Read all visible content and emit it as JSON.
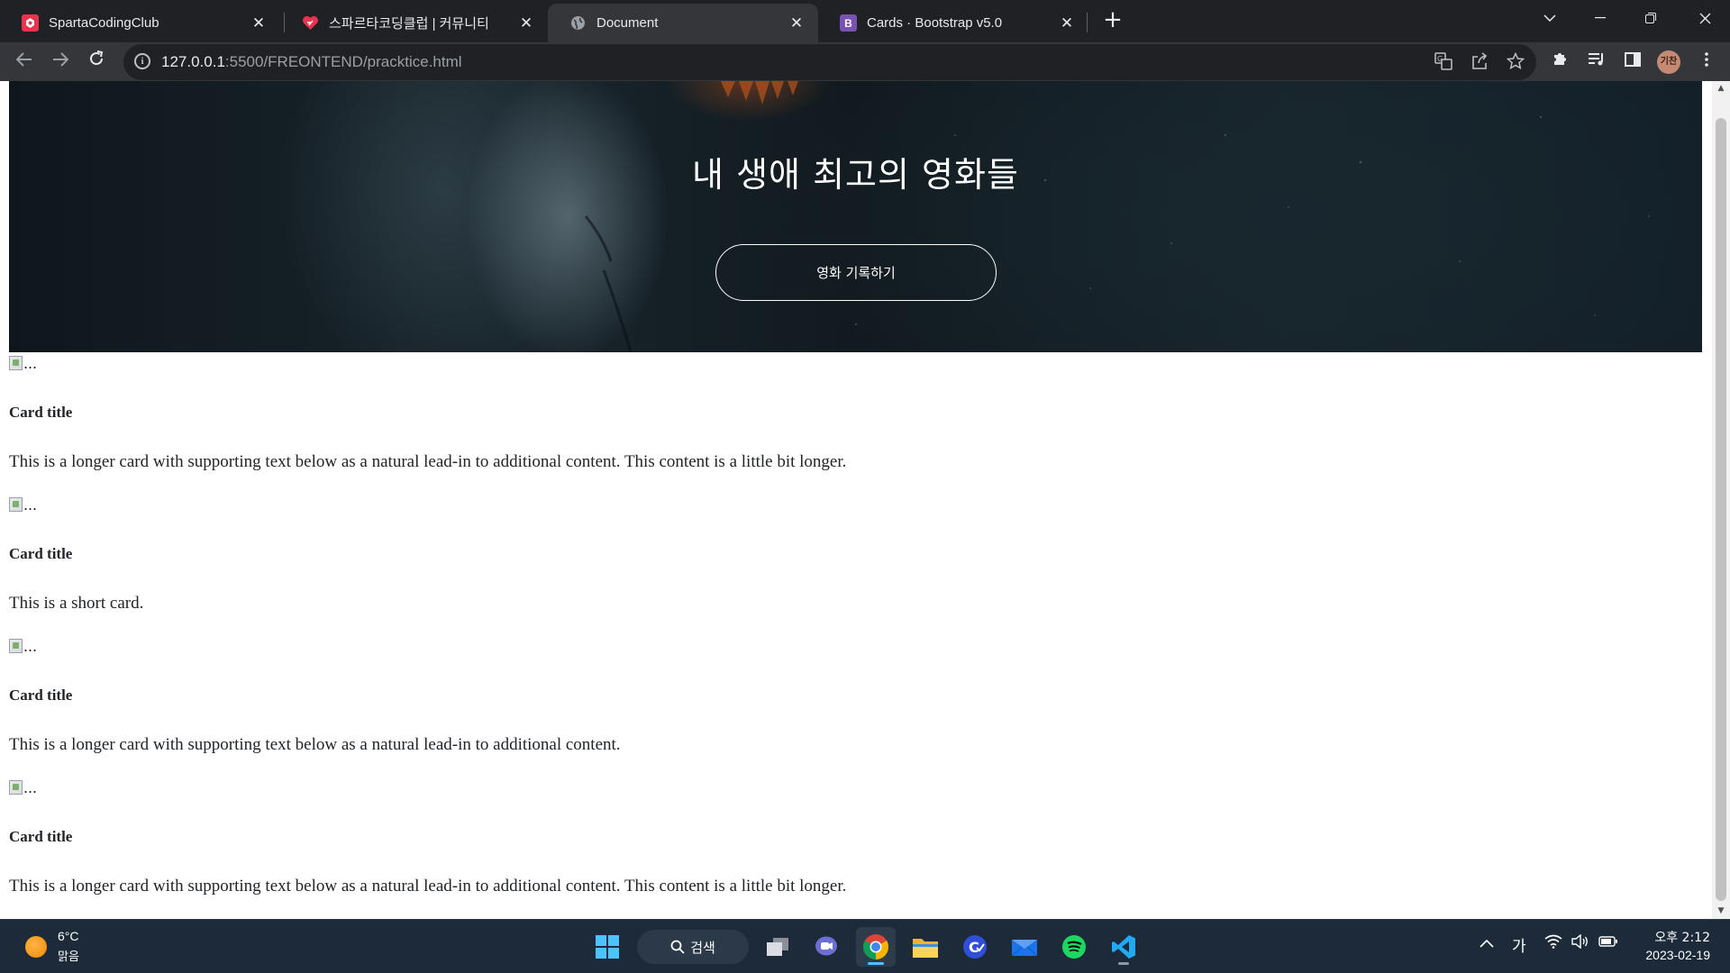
{
  "browser": {
    "tabs": [
      {
        "title": "SpartaCodingClub",
        "favicon": "sparta-icon",
        "color": "#e8344e",
        "active": false
      },
      {
        "title": "스파르타코딩클럽 | 커뮤니티",
        "favicon": "heart-chat-icon",
        "color": "#e8344e",
        "active": false
      },
      {
        "title": "Document",
        "favicon": "globe-icon",
        "color": "#9aa0a6",
        "active": true
      },
      {
        "title": "Cards · Bootstrap v5.0",
        "favicon": "bootstrap-icon",
        "fav_letter": "B",
        "color": "#7952b3",
        "active": false
      }
    ],
    "close_glyph": "✕",
    "new_tab_glyph": "+",
    "url_host": "127.0.0.1",
    "url_rest": ":5500/FREONTEND/pracktice.html",
    "profile_initials": "기찬"
  },
  "hero": {
    "title": "내 생애 최고의 영화들",
    "button_label": "영화 기록하기"
  },
  "cards": [
    {
      "img_alt": "...",
      "title": "Card title",
      "text": "This is a longer card with supporting text below as a natural lead-in to additional content. This content is a little bit longer."
    },
    {
      "img_alt": "...",
      "title": "Card title",
      "text": "This is a short card."
    },
    {
      "img_alt": "...",
      "title": "Card title",
      "text": "This is a longer card with supporting text below as a natural lead-in to additional content."
    },
    {
      "img_alt": "...",
      "title": "Card title",
      "text": "This is a longer card with supporting text below as a natural lead-in to additional content. This content is a little bit longer."
    }
  ],
  "taskbar": {
    "weather_temp": "6°C",
    "weather_desc": "맑음",
    "search_label": "검색",
    "ime_label": "가",
    "time": "오후 2:12",
    "date": "2023-02-19"
  },
  "colors": {
    "tabstrip_bg": "#202124",
    "toolbar_bg": "#35363a",
    "taskbar_bg": "#1c2a3a",
    "accent_indicator": "#4cc2ff"
  }
}
